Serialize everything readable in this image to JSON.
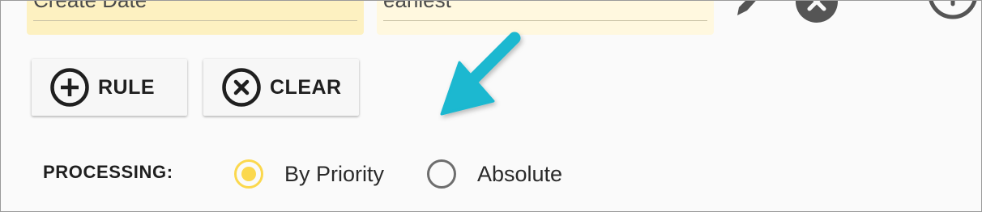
{
  "filter_row": {
    "field_1_value": "Create Date",
    "field_2_value": "earliest",
    "icons": [
      "pencil-icon",
      "remove-circle-icon",
      "add-circle-icon"
    ]
  },
  "toolbar": {
    "rule_label": "RULE",
    "clear_label": "CLEAR",
    "rule_icon": "add-circle-icon",
    "clear_icon": "remove-circle-icon"
  },
  "processing": {
    "label": "PROCESSING:",
    "options": [
      {
        "label": "By Priority",
        "selected": true
      },
      {
        "label": "Absolute",
        "selected": false
      }
    ]
  },
  "colors": {
    "accent": "#fbd84e",
    "field_bg": "#fdf1c1",
    "annotation_arrow": "#1ab8d0",
    "text": "#1f1f1f"
  }
}
